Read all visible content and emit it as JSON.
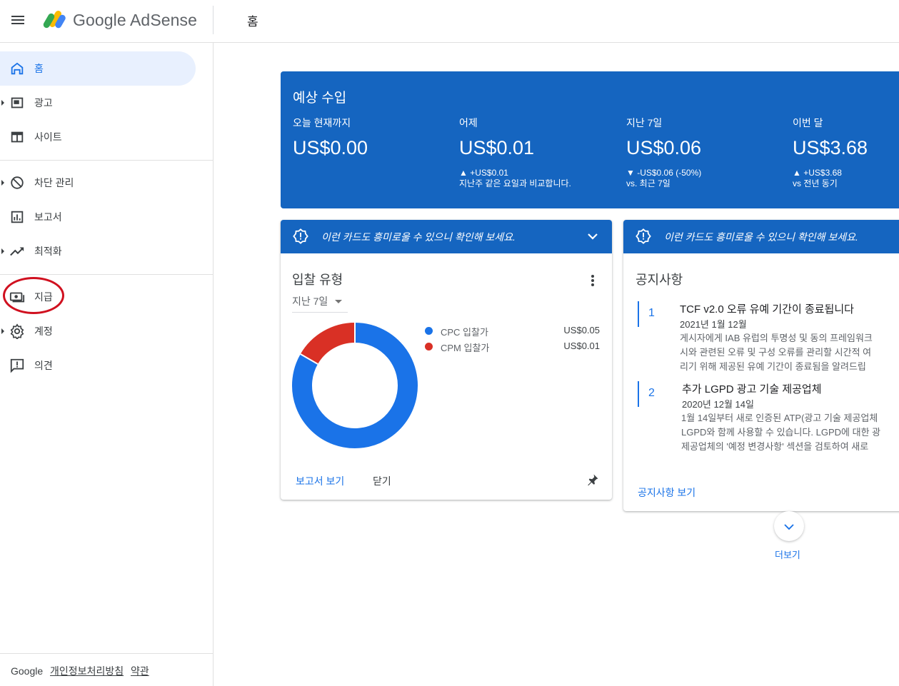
{
  "header": {
    "brand": "Google AdSense",
    "page_title": "홈"
  },
  "sidebar": {
    "items": [
      {
        "label": "홈",
        "icon": "home-icon",
        "active": true
      },
      {
        "label": "광고",
        "icon": "ads-icon"
      },
      {
        "label": "사이트",
        "icon": "sites-icon"
      },
      {
        "label": "차단 관리",
        "icon": "block-icon"
      },
      {
        "label": "보고서",
        "icon": "reports-icon"
      },
      {
        "label": "최적화",
        "icon": "trending-up-icon"
      },
      {
        "label": "지급",
        "icon": "payments-icon"
      },
      {
        "label": "계정",
        "icon": "gear-icon"
      },
      {
        "label": "의견",
        "icon": "feedback-icon"
      }
    ],
    "footer": {
      "brand": "Google",
      "privacy": "개인정보처리방침",
      "terms": "약관"
    }
  },
  "earnings": {
    "title": "예상 수입",
    "columns": [
      {
        "label": "오늘 현재까지",
        "value": "US$0.00",
        "delta": "",
        "note": ""
      },
      {
        "label": "어제",
        "value": "US$0.01",
        "delta": "▲ +US$0.01",
        "note": "지난주 같은 요일과 비교합니다."
      },
      {
        "label": "지난 7일",
        "value": "US$0.06",
        "delta": "▼ -US$0.06 (-50%)",
        "note": "vs. 최근 7일"
      },
      {
        "label": "이번 달",
        "value": "US$3.68",
        "delta": "▲ +US$3.68",
        "note": "vs 전년 동기"
      }
    ]
  },
  "bid_card": {
    "banner": "이런 카드도 흥미로울 수 있으니 확인해 보세요.",
    "title": "입찰 유형",
    "period": "지난 7일",
    "legend": [
      {
        "name": "CPC 입찰가",
        "value": "US$0.05",
        "color": "#1a73e8"
      },
      {
        "name": "CPM 입찰가",
        "value": "US$0.01",
        "color": "#d93025"
      }
    ],
    "report_link": "보고서 보기",
    "close": "닫기"
  },
  "chart_data": {
    "type": "pie",
    "categories": [
      "CPC 입찰가",
      "CPM 입찰가"
    ],
    "values": [
      0.05,
      0.01
    ],
    "title": "입찰 유형"
  },
  "notice_card": {
    "banner": "이런 카드도 흥미로울 수 있으니 확인해 보세요.",
    "title": "공지사항",
    "items": [
      {
        "num": "1",
        "title": "TCF v2.0 오류 유예 기간이 종료됩니다",
        "date": "2021년 1월 12월",
        "lines": [
          "게시자에게 IAB 유럽의 투명성 및 동의 프레임워크",
          "시와 관련된 오류 및 구성 오류를 관리할 시간적 여",
          "리기 위해 제공된 유예 기간이 종료됨을 알려드립"
        ]
      },
      {
        "num": "2",
        "title": "추가 LGPD 광고 기술 제공업체",
        "date": "2020년 12월 14일",
        "lines": [
          "1월 14일부터 새로 인증된 ATP(광고 기술 제공업체",
          "LGPD와 함께 사용할 수 있습니다. LGPD에 대한 광",
          "제공업체의 '예정 변경사항' 섹션을 검토하여 새로"
        ]
      }
    ],
    "link": "공지사항 보기"
  },
  "more": {
    "label": "더보기"
  }
}
